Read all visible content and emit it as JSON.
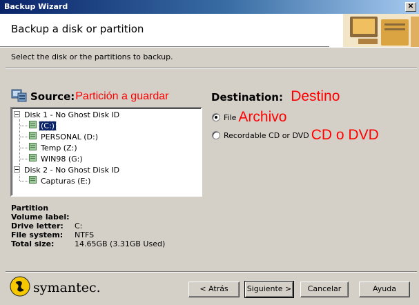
{
  "window": {
    "title": "Backup Wizard",
    "close_label": "✕"
  },
  "header": {
    "title": "Backup a disk or partition"
  },
  "instructions": "Select the disk or the partitions to backup.",
  "source": {
    "label": "Source:",
    "annotation": "Partición a guardar"
  },
  "tree": {
    "disk1": "Disk 1 - No Ghost Disk ID",
    "disk1_partitions": [
      "(C:)",
      "PERSONAL (D:)",
      "Temp (Z:)",
      "WIN98 (G:)"
    ],
    "disk2": "Disk 2 - No Ghost Disk ID",
    "disk2_partitions": [
      "Capturas (E:)"
    ],
    "selected": "(C:)"
  },
  "destination": {
    "label": "Destination:",
    "annotation": "Destino",
    "options": [
      {
        "label": "File",
        "annotation": "Archivo",
        "selected": true
      },
      {
        "label": "Recordable CD or DVD",
        "annotation": "CD o DVD",
        "selected": false
      }
    ]
  },
  "partition_info": {
    "heading": "Partition",
    "rows": [
      {
        "key": "Volume label:",
        "value": ""
      },
      {
        "key": "Drive letter:",
        "value": "C:"
      },
      {
        "key": "File system:",
        "value": "NTFS"
      },
      {
        "key": "Total size:",
        "value": "14.65GB (3.31GB Used)"
      }
    ]
  },
  "brand": {
    "name": "symantec."
  },
  "buttons": {
    "back": "< Atrás",
    "next": "Siguiente >",
    "cancel": "Cancelar",
    "help": "Ayuda"
  },
  "colors": {
    "titlebar": "#0a246a",
    "annotation": "#ff0000",
    "selection": "#0a246a"
  }
}
